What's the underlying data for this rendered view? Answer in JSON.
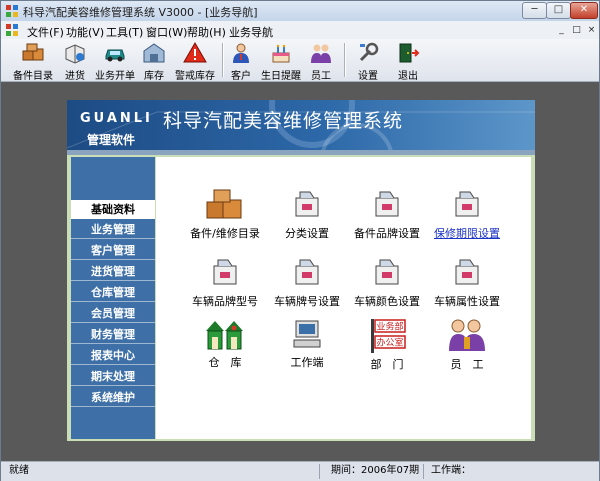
{
  "window": {
    "title": "科导汽配美容维修管理系统 V3000 - [业务导航]",
    "minimize_symbol": "─",
    "maximize_symbol": "□",
    "close_symbol": "✕"
  },
  "menu": {
    "items": [
      "文件(F)",
      "功能(V)",
      "工具(T)",
      "窗口(W)",
      "帮助(H)",
      "业务导航"
    ],
    "mdi_controls": [
      "_",
      "□",
      "×"
    ]
  },
  "toolbar": {
    "buttons": [
      "备件目录",
      "进货",
      "业务开单",
      "库存",
      "警戒库存",
      "客户",
      "生日提醒",
      "员工",
      "设置",
      "退出"
    ]
  },
  "banner": {
    "brand": "GUANLI",
    "subtitle": "管理软件",
    "system_name": "科导汽配美容维修管理系统"
  },
  "nav": {
    "items": [
      "基础资料",
      "业务管理",
      "客户管理",
      "进货管理",
      "仓库管理",
      "会员管理",
      "财务管理",
      "报表中心",
      "期末处理",
      "系统维护"
    ],
    "active_index": 0
  },
  "grid": {
    "row1": [
      "备件/维修目录",
      "分类设置",
      "备件品牌设置",
      "保修期限设置"
    ],
    "row2": [
      "车辆品牌型号",
      "车辆牌号设置",
      "车辆颜色设置",
      "车辆属性设置"
    ],
    "row3": [
      "仓　库",
      "工作端",
      "部　门",
      "员　工"
    ],
    "dept_sign_top": "业务部",
    "dept_sign_bottom": "办公室"
  },
  "status": {
    "ready": "就绪",
    "period": "期间：2006年07期",
    "workstation": "工作端："
  },
  "colors": {
    "nav_bg": "#3e6fa6",
    "panel_green": "#c9ddb6",
    "banner_dark": "#1d4b84",
    "link": "#1a32c8",
    "mdi_bg": "#595959"
  }
}
